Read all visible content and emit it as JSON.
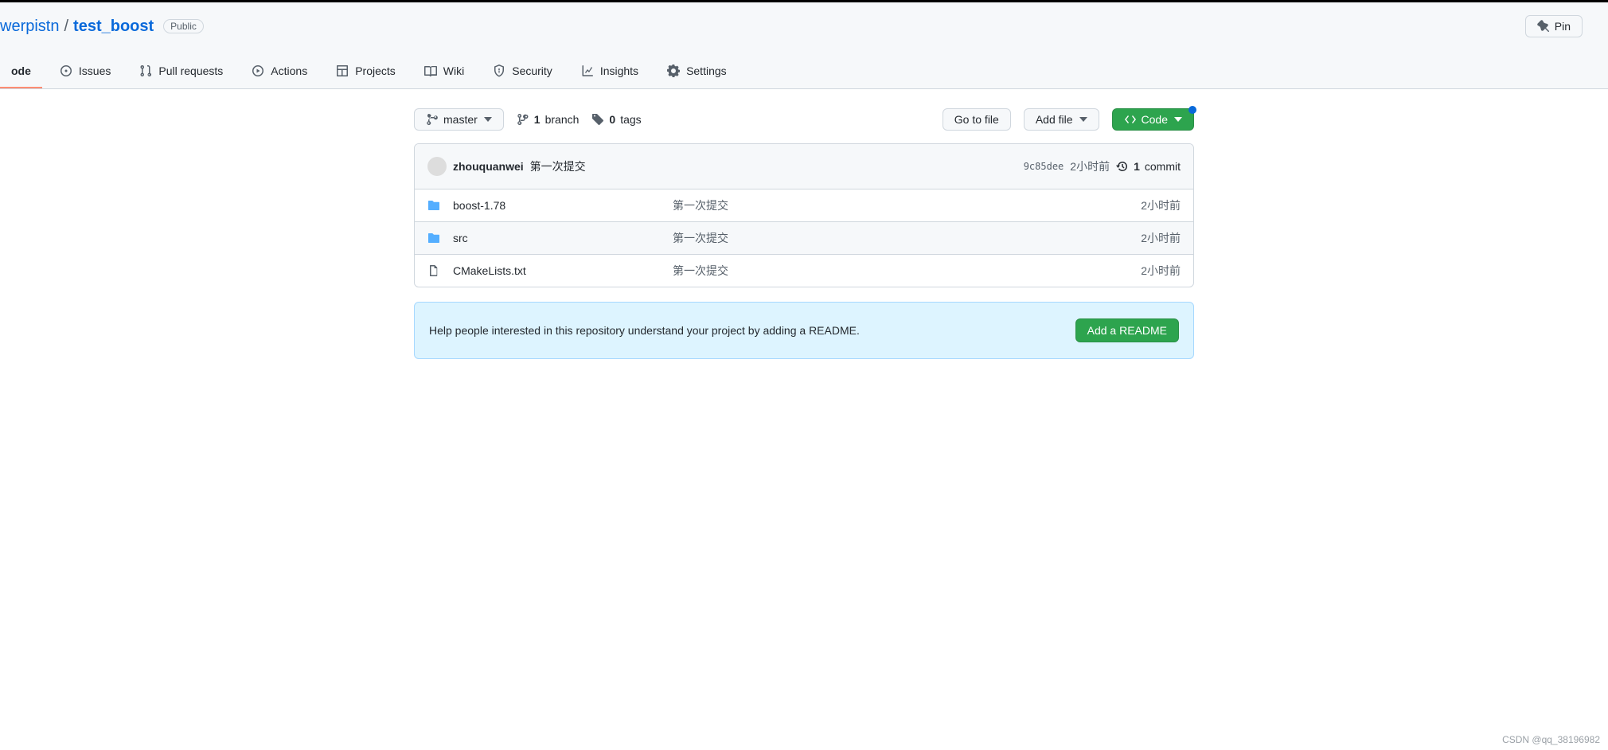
{
  "header": {
    "owner": "werpistn",
    "repo": "test_boost",
    "visibility": "Public",
    "pin_label": "Pin"
  },
  "nav": {
    "code": "ode",
    "issues": "Issues",
    "pulls": "Pull requests",
    "actions": "Actions",
    "projects": "Projects",
    "wiki": "Wiki",
    "security": "Security",
    "insights": "Insights",
    "settings": "Settings"
  },
  "actions": {
    "branch_btn": "master",
    "branch_count": "1",
    "branch_label": "branch",
    "tag_count": "0",
    "tag_label": "tags",
    "go_to_file": "Go to file",
    "add_file": "Add file",
    "code_btn": "Code"
  },
  "latest_commit": {
    "author": "zhouquanwei",
    "message": "第一次提交",
    "sha": "9c85dee",
    "time": "2小时前",
    "commits_count": "1",
    "commits_label": "commit"
  },
  "files": [
    {
      "type": "dir",
      "name": "boost-1.78",
      "msg": "第一次提交",
      "time": "2小时前"
    },
    {
      "type": "dir",
      "name": "src",
      "msg": "第一次提交",
      "time": "2小时前"
    },
    {
      "type": "file",
      "name": "CMakeLists.txt",
      "msg": "第一次提交",
      "time": "2小时前"
    }
  ],
  "readme": {
    "text": "Help people interested in this repository understand your project by adding a README.",
    "button": "Add a README"
  },
  "watermark": "CSDN @qq_38196982"
}
